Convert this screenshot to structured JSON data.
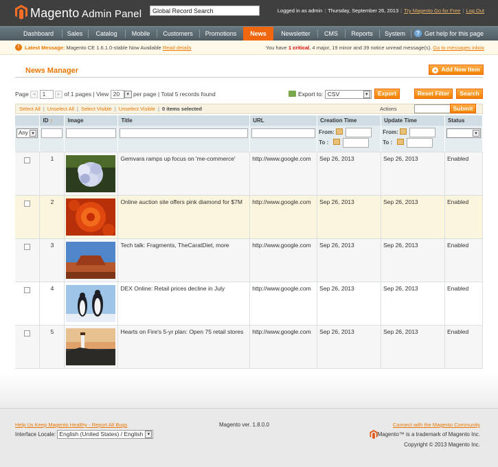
{
  "header": {
    "logo_main": "Magento",
    "logo_sub": "Admin Panel",
    "global_search_placeholder": "Global Record Search",
    "logged_in": "Logged in as admin",
    "date": "Thursday, September 26, 2013",
    "try_link": "Try Magento Go for Free",
    "logout_link": "Log Out"
  },
  "nav": {
    "items": [
      {
        "label": "Dashboard"
      },
      {
        "label": "Sales"
      },
      {
        "label": "Catalog"
      },
      {
        "label": "Mobile"
      },
      {
        "label": "Customers"
      },
      {
        "label": "Promotions"
      },
      {
        "label": "News"
      },
      {
        "label": "Newsletter"
      },
      {
        "label": "CMS"
      },
      {
        "label": "Reports"
      },
      {
        "label": "System"
      }
    ],
    "active": "News",
    "help": "Get help for this page"
  },
  "message": {
    "prefix": "Latest Message:",
    "text": "Magento CE 1.6.1.0-stable Now Available",
    "link": "Read details",
    "right_prefix": "You have",
    "critical_count": "1",
    "critical_label": "critical",
    "right_rest": ", 4 major, 19 minor and 39 notice unread message(s).",
    "inbox_link": "Go to messages inbox"
  },
  "page": {
    "title": "News Manager",
    "add_button": "Add New Item"
  },
  "pager": {
    "page_label": "Page",
    "page_value": "1",
    "of_pages": "of 1 pages",
    "view_label": "View",
    "view_value": "20",
    "per_page": "per page",
    "records": "Total 5 records found"
  },
  "export": {
    "label": "Export to:",
    "format": "CSV",
    "export_button": "Export",
    "reset_button": "Reset Filter",
    "search_button": "Search"
  },
  "massaction": {
    "select_all": "Select All",
    "unselect_all": "Unselect All",
    "select_visible": "Select Visible",
    "unselect_visible": "Unselect Visible",
    "selected": "0 items selected",
    "actions_label": "Actions",
    "submit": "Submit"
  },
  "grid": {
    "columns": [
      "",
      "ID",
      "Image",
      "Title",
      "URL",
      "Creation Time",
      "Update Time",
      "Status"
    ],
    "sort_arrow": "↑",
    "filter_any": "Any",
    "from_label": "From:",
    "to_label": "To :",
    "rows": [
      {
        "id": "1",
        "title": "Gemvara ramps up focus on 'me-commerce'",
        "url": "http://www.google.com",
        "created": "Sep 26, 2013",
        "updated": "Sep 26, 2013",
        "status": "Enabled"
      },
      {
        "id": "2",
        "title": "Online auction site offers pink diamond for $7M",
        "url": "http://www.google.com",
        "created": "Sep 26, 2013",
        "updated": "Sep 26, 2013",
        "status": "Enabled"
      },
      {
        "id": "3",
        "title": "Tech talk: Fragments, TheCaratDiet, more",
        "url": "http://www.google.com",
        "created": "Sep 26, 2013",
        "updated": "Sep 26, 2013",
        "status": "Enabled"
      },
      {
        "id": "4",
        "title": "DEX Online: Retail prices decline in July",
        "url": "http://www.google.com",
        "created": "Sep 26, 2013",
        "updated": "Sep 26, 2013",
        "status": "Enabled"
      },
      {
        "id": "5",
        "title": "Hearts on Fire's 5-yr plan: Open 75 retail stores",
        "url": "http://www.google.com",
        "created": "Sep 26, 2013",
        "updated": "Sep 26, 2013",
        "status": "Enabled"
      }
    ]
  },
  "footer": {
    "help_link": "Help Us Keep Magento Healthy - Report All Bugs",
    "locale_label": "Interface Locale:",
    "locale_value": "English (United States) / English",
    "version": "Magento ver. 1.8.0.0",
    "community_link": "Connect with the Magento Community",
    "trademark": "Magento™ is a trademark of Magento Inc.",
    "copyright": "Copyright © 2013 Magento Inc."
  },
  "colors": {
    "accent": "#ea7601",
    "nav_active": "#f0670f",
    "header_bg": "#3f3f3f",
    "grid_header": "#d1dde5"
  }
}
